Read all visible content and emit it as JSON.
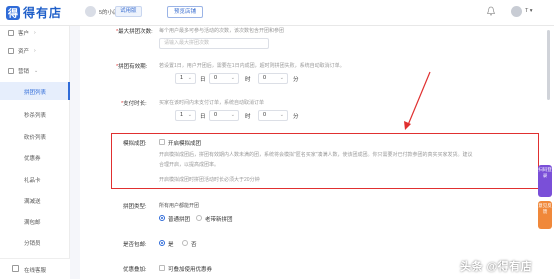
{
  "brand": {
    "logo_char": "得",
    "name": "得有店",
    "icon": "store-logo-icon"
  },
  "header": {
    "shop_name": "5的小店",
    "trial_badge": "试用版",
    "preview_button": "预览店铺",
    "user_name": "T",
    "user_caret": "▾",
    "bell_icon": "bell-icon"
  },
  "sidebar": {
    "groups": [
      {
        "label": "客户",
        "icon": "customer-icon",
        "arrow": "›"
      },
      {
        "label": "资产",
        "icon": "asset-icon",
        "arrow": "›"
      },
      {
        "label": "营销",
        "icon": "marketing-icon",
        "arrow": "⌄"
      }
    ],
    "subitems": [
      "拼团列表",
      "秒杀列表",
      "砍价列表",
      "优惠券",
      "礼品卡",
      "满减送",
      "满包邮",
      "分销员"
    ],
    "active_subitem": "拼团列表",
    "support": {
      "label": "在线客服",
      "icon": "support-icon"
    }
  },
  "form": {
    "max_join": {
      "label": "最大拼团次数:",
      "hint": "每个用户最多可参与活动的次数，该次数包含开团和参团",
      "placeholder": "请输入最大拼团次数"
    },
    "validity": {
      "label": "拼团有效期:",
      "hint": "若设置1日，用户开团后，需要在1日内成团，超时则拼团失败，系统自动取消订单。",
      "day_value": "1",
      "day_unit": "日",
      "hour_value": "0",
      "hour_unit": "时",
      "minute_value": "0",
      "minute_unit": "分"
    },
    "pay_time": {
      "label": "支付时长:",
      "hint": "买家在该时间内未支付订单，系统自动取消订单",
      "day_value": "1",
      "day_unit": "日",
      "hour_value": "0",
      "hour_unit": "时",
      "minute_value": "0",
      "minute_unit": "分"
    },
    "simulate": {
      "label": "模拟成团:",
      "checkbox_label": "开启模拟成团",
      "desc_line1": "开启模拟成团后，拼团有效期内人数未满的团，系统将会模拟\"匿名买家\"凑满人数，使该团成团。你只需要对已付款参团的真实买家发货。建议",
      "desc_line2": "合理开启，以提高成团率。",
      "desc_line3": "开启模拟成团时拼团活动时长必须大于20分钟"
    },
    "group_type": {
      "label": "拼团类型:",
      "hint": "所有用户都能开团",
      "options": [
        "普通拼团",
        "老带新拼团"
      ],
      "selected": "普通拼团"
    },
    "include_shipping": {
      "label": "是否包邮:",
      "options": [
        "是",
        "否"
      ],
      "selected": "是"
    },
    "coupon_stack": {
      "label": "优惠叠加:",
      "checkbox_label": "可叠加使用优惠券"
    }
  },
  "float_buttons": [
    "扫码登录",
    "意见反馈"
  ],
  "watermark": "头条 @得有店",
  "colors": {
    "brand_blue": "#2f6bd8",
    "highlight_red": "#e03030",
    "float_purple": "#7a4fd8",
    "float_orange": "#f0883a"
  }
}
